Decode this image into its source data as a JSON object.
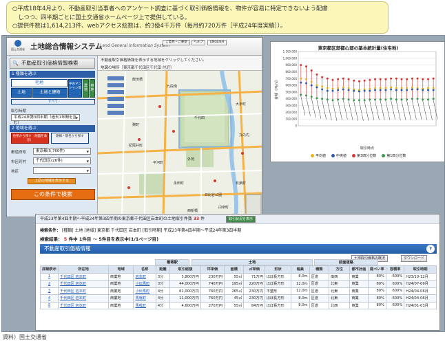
{
  "note": {
    "line1": "○平成18年4月より、不動産取引当事者へのアンケート調査に基づく取引価格情報を、物件が容易に特定できないよう配慮",
    "line2": "　しつつ、四半期ごとに国土交通省ホームページ上で提供している。",
    "line3": "○提供件数は1,614,213件、webアクセス総数は、約3億4千万件（毎月約720万件［平成24年度実績］）。"
  },
  "app": {
    "logo_caption": "国土交通省",
    "title": "土地総合情報システム",
    "subtitle": "Land General Information System",
    "header_buttons": [
      "ご意見・ご要望",
      "ヘルプ",
      "ENGLISH"
    ],
    "search_header": "不動産取引価格情報検索",
    "step1": "1 種類を選ぶ",
    "type_takuchi": "宅地",
    "type_land": "土地",
    "type_land_building": "土地と建物",
    "type_mansion": "中古マンション等",
    "type_farm": "農地",
    "type_forest": "林地",
    "type_all": "すべて",
    "period_label": "取引時期",
    "period_value": "平成24年第3四半期（過去1年間を含む）",
    "step2": "2 地域を選ぶ",
    "region_btn1": "住所から探す（地図を表示）",
    "region_btn2": "路線・駅名から探す",
    "pref_label": "都道府県",
    "pref_value": "東京都(5,760件)",
    "city_label": "市区町村",
    "city_value": "千代田区(26件)",
    "area_label": "地区",
    "area_value": "",
    "search_btn": "上記の地域を表示する",
    "search_big": "この条件で検索",
    "map_hint": "不動産取引価格情報を表示する地域をクリックしてください。",
    "map_location": "地図の場所［東京都千代田区千代田 付近］",
    "map_labels": [
      "千代田",
      "九段南",
      "飯田橋",
      "大手町",
      "丸の内",
      "有楽町",
      "永田町",
      "麹町",
      "平河町",
      "紀尾井町",
      "内幸町",
      "日比谷公園",
      "外苑",
      "西新橋"
    ]
  },
  "chart_data": {
    "type": "line",
    "title": "東京都区部都心部の基本統計量(住宅地)",
    "ylabel": "金額（円/㎡）",
    "xlabel": "取引時点",
    "ylim": [
      0,
      1100000
    ],
    "yticks": [
      "1,100,000",
      "1,000,000",
      "900,000",
      "800,000",
      "700,000",
      "600,000",
      "500,000",
      "400,000",
      "300,000",
      "200,000",
      "100,000",
      "0"
    ],
    "series": [
      {
        "name": "平均値",
        "values": [
          700000,
          690000,
          650000,
          600000,
          580000,
          560000,
          550000,
          560000,
          570000,
          560000,
          540000,
          530000,
          540000,
          550000,
          560000,
          560000,
          560000,
          570000,
          560000,
          560000,
          560000,
          570000,
          560000,
          550000,
          560000,
          560000
        ]
      },
      {
        "name": "中央値",
        "values": [
          640000,
          630000,
          600000,
          570000,
          540000,
          520000,
          520000,
          530000,
          540000,
          530000,
          520000,
          510000,
          520000,
          520000,
          530000,
          530000,
          530000,
          540000,
          530000,
          530000,
          530000,
          540000,
          540000,
          530000,
          530000,
          530000
        ]
      },
      {
        "name": "第3四分位数",
        "values": [
          900000,
          880000,
          820000,
          760000,
          720000,
          700000,
          680000,
          690000,
          700000,
          690000,
          670000,
          660000,
          670000,
          680000,
          690000,
          690000,
          690000,
          700000,
          700000,
          690000,
          690000,
          700000,
          700000,
          690000,
          690000,
          700000
        ]
      },
      {
        "name": "第1四分位数",
        "values": [
          460000,
          450000,
          430000,
          410000,
          400000,
          390000,
          380000,
          390000,
          400000,
          390000,
          380000,
          380000,
          380000,
          390000,
          390000,
          390000,
          390000,
          400000,
          390000,
          390000,
          390000,
          400000,
          400000,
          390000,
          390000,
          400000
        ]
      }
    ],
    "series_colors": [
      "#e8b51d",
      "#2e5caa",
      "#d93636",
      "#3c9a4c"
    ]
  },
  "results": {
    "header": "平成23年第4四半期～平成24年第3四半期の東京都千代田区岩本町の土地取引件数",
    "header_count": "33",
    "header_unit": "件",
    "header_btn": "取引状況を表示",
    "criteria_label": "検索条件：",
    "criteria_value": "[種類] 土地 [地域] 東京都 千代田区 岩本町 [取引時期] 平成23年第4四半期～平成24年第3四半期",
    "count_label": "検索結果：",
    "count_value": "5",
    "count_text": "件中 1件目 ～ 5件目を表示中(1/1ページ目)",
    "section_title": "不動産取引価格情報",
    "help": "?",
    "btn_about": "土地取引価格の概況",
    "btn_download": "ダウンロード",
    "group_station": "最寄駅",
    "group_land": "土地",
    "group_road": "前面道路",
    "columns": [
      "詳細表示",
      "所在地",
      "地域",
      "名称",
      "距離",
      "取引総額",
      "坪単価",
      "面積",
      "㎡単価",
      "形状",
      "幅員",
      "種類",
      "方位",
      "都市計画",
      "建ぺい率",
      "容積率",
      "取引時期"
    ],
    "rows": [
      [
        "1",
        "千代田区 岩本町",
        "商業地",
        "岩本町",
        "3分",
        "3,800万円",
        "230万円",
        "55㎡",
        "71万円",
        "ほぼ長方形",
        "8.0m",
        "区道",
        "南西",
        "商業",
        "80%",
        "600%",
        "H23/10-12月"
      ],
      [
        "2",
        "千代田区 岩本町",
        "商業地",
        "小伝馬町",
        "3分",
        "44,000万円",
        "740万円",
        "195㎡",
        "220万円",
        "ほぼ長方形",
        "12.0m",
        "区道",
        "北東",
        "商業",
        "80%",
        "600%",
        "H24/07-09月"
      ],
      [
        "3",
        "千代田区 岩本町",
        "商業地",
        "小伝馬町",
        "4分",
        "61,000万円",
        "760万円",
        "265㎡",
        "230万円",
        "不整形",
        "12.0m",
        "区道",
        "北東",
        "商業",
        "80%",
        "600%",
        "H24/04-06月"
      ],
      [
        "4",
        "千代田区 岩本町",
        "商業地",
        "馬喰町",
        "4分",
        "11,000万円",
        "760万円",
        "45㎡",
        "230万円",
        "ほぼ長方形",
        "8.0m",
        "区道",
        "北東",
        "商業",
        "80%",
        "600%",
        "H24/04-06月"
      ],
      [
        "5",
        "千代田区 岩本町",
        "商業地",
        "馬喰町",
        "4分",
        "4,600万円",
        "270万円",
        "55㎡",
        "84万円",
        "ほぼ長方形",
        "8.0m",
        "区道",
        "北西",
        "商業",
        "80%",
        "600%",
        "H24/01-03月"
      ]
    ]
  },
  "source": "資料）国土交通省"
}
